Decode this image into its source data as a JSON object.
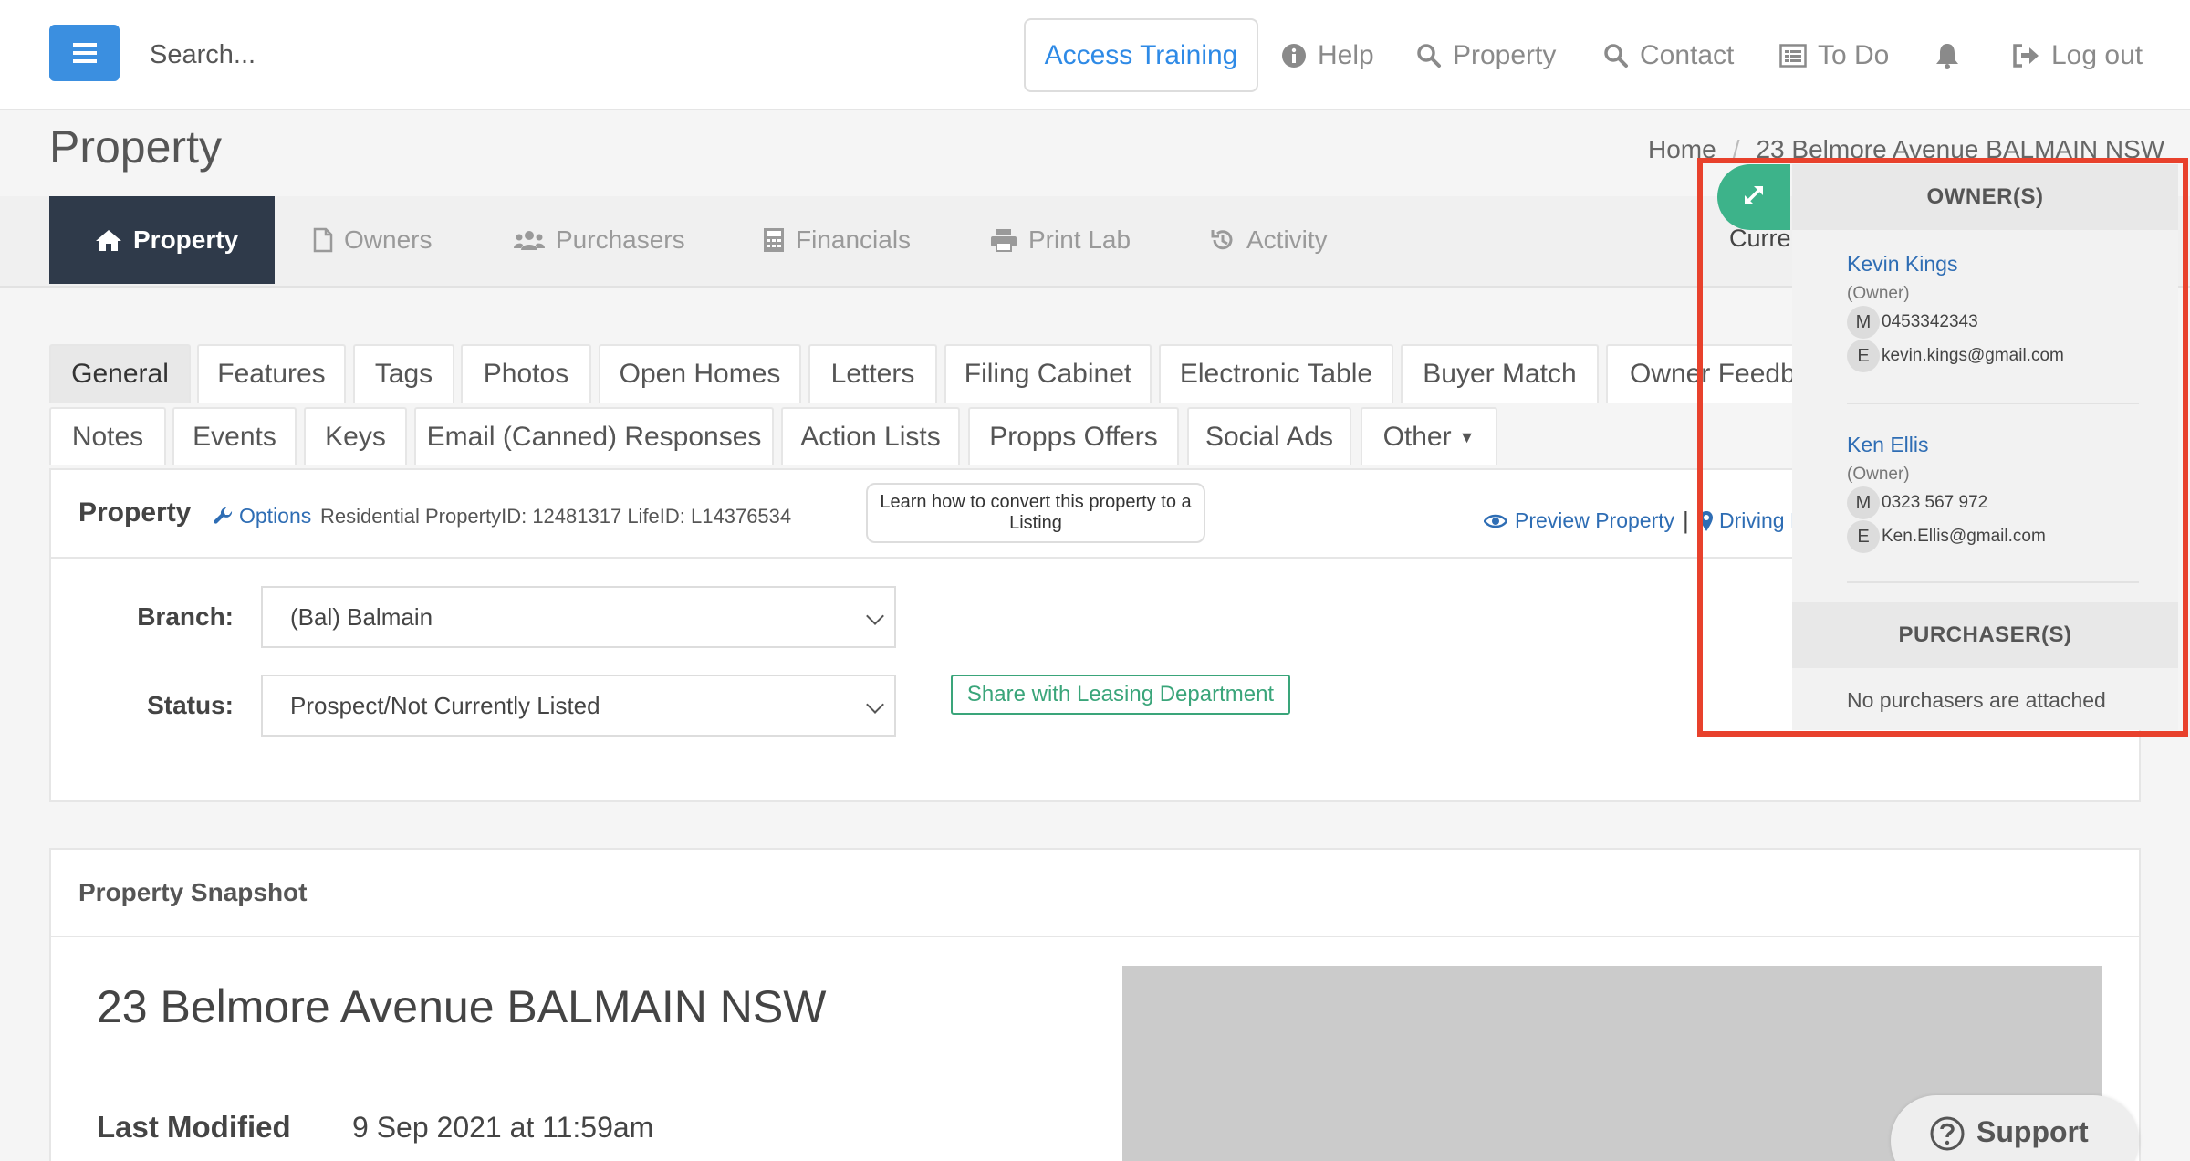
{
  "topbar": {
    "search_placeholder": "Search...",
    "access_training": "Access Training",
    "help": "Help",
    "property": "Property",
    "contact": "Contact",
    "todo": "To Do",
    "logout": "Log out"
  },
  "page": {
    "title": "Property",
    "breadcrumb_home": "Home",
    "breadcrumb_separator": "/",
    "breadcrumb_current": "23 Belmore Avenue BALMAIN NSW"
  },
  "main_tabs": {
    "property": "Property",
    "owners": "Owners",
    "purchasers": "Purchasers",
    "financials": "Financials",
    "print_lab": "Print Lab",
    "activity": "Activity"
  },
  "sub_tabs": {
    "row1": [
      "General",
      "Features",
      "Tags",
      "Photos",
      "Open Homes",
      "Letters",
      "Filing Cabinet",
      "Electronic Table",
      "Buyer Match",
      "Owner Feedba"
    ],
    "row2": [
      "Notes",
      "Events",
      "Keys",
      "Email (Canned) Responses",
      "Action Lists",
      "Propps Offers",
      "Social Ads",
      "Other"
    ]
  },
  "property_panel": {
    "title": "Property",
    "options": "Options",
    "meta": "Residential PropertyID: 12481317 LifeID: L14376534",
    "learn_button": "Learn how to convert this property to a Listing",
    "preview_property": "Preview Property",
    "pipe": "|",
    "driving": "Driving Directions",
    "branch_label": "Branch:",
    "branch_value": "(Bal) Balmain",
    "status_label": "Status:",
    "status_value": "Prospect/Not Currently Listed",
    "share_button": "Share with Leasing Department"
  },
  "snapshot": {
    "title": "Property Snapshot",
    "address": "23 Belmore Avenue BALMAIN NSW",
    "last_modified_label": "Last Modified",
    "last_modified_value": "9 Sep 2021 at 11:59am"
  },
  "support": {
    "label": "Support"
  },
  "sidebar": {
    "current_tab": "Current",
    "owners_heading": "OWNER(S)",
    "owners": [
      {
        "name": "Kevin Kings",
        "role": "(Owner)",
        "mobile_badge": "M",
        "mobile": "0453342343",
        "email_badge": "E",
        "email": "kevin.kings@gmail.com"
      },
      {
        "name": "Ken Ellis",
        "role": "(Owner)",
        "mobile_badge": "M",
        "mobile": "0323 567 972",
        "email_badge": "E",
        "email": "Ken.Ellis@gmail.com"
      }
    ],
    "purchasers_heading": "PURCHASER(S)",
    "no_purchasers": "No purchasers are attached"
  },
  "colors": {
    "accent_blue": "#3b8fe0",
    "link_blue": "#2e6db4",
    "active_tab_bg": "#2f3a4a",
    "green": "#3aa57a",
    "highlight_red": "#e8412c"
  }
}
